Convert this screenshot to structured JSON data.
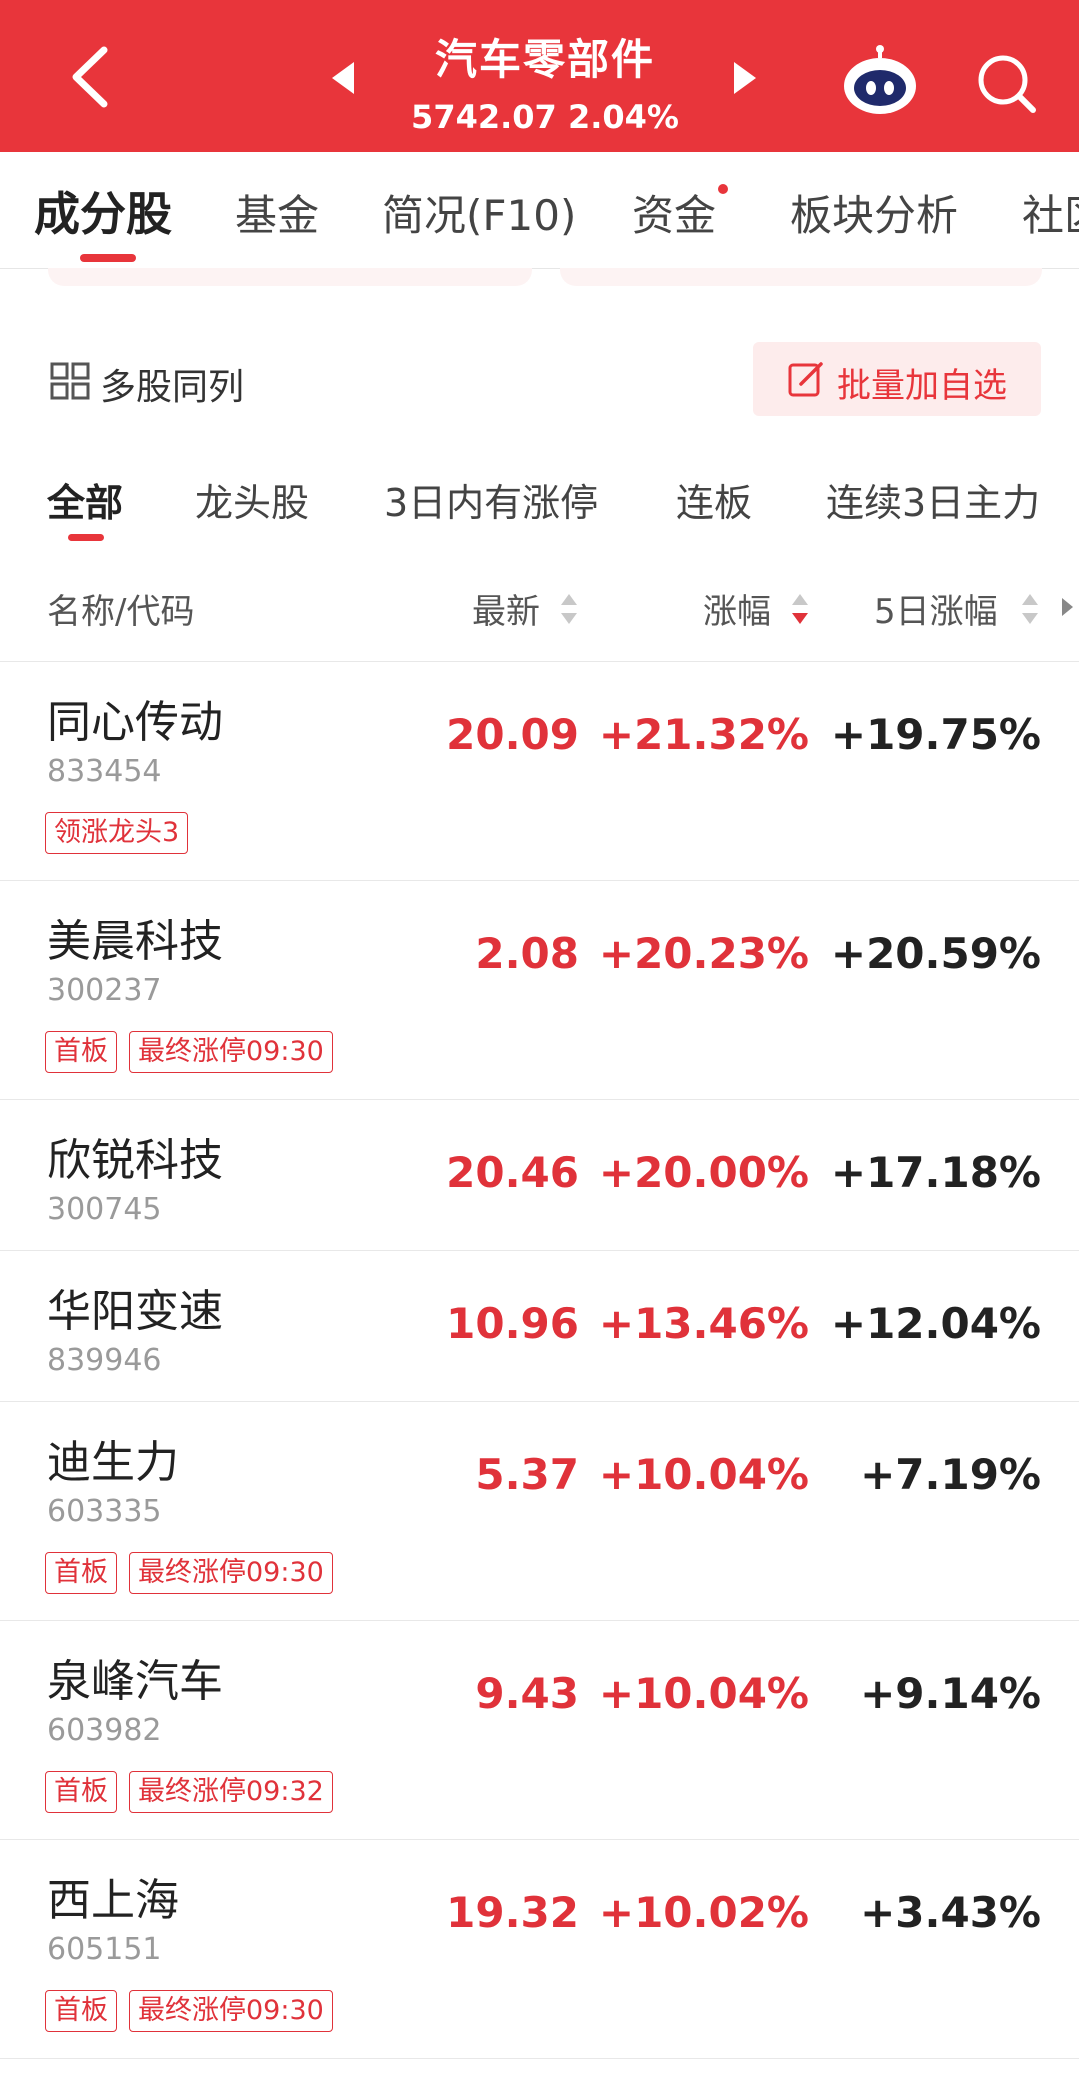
{
  "header": {
    "title": "汽车零部件",
    "index_value": "5742.07",
    "index_change": "2.04%",
    "accent": "#e8353b"
  },
  "tabs": [
    "成分股",
    "基金",
    "简况(F10)",
    "资金",
    "板块分析",
    "社区"
  ],
  "toolbar": {
    "multi_label": "多股同列",
    "batch_label": "批量加自选"
  },
  "filters": [
    "全部",
    "龙头股",
    "3日内有涨停",
    "连板",
    "连续3日主力"
  ],
  "table_header": {
    "name": "名称/代码",
    "latest": "最新",
    "change": "涨幅",
    "change5": "5日涨幅"
  },
  "rows": [
    {
      "name": "同心传动",
      "code": "833454",
      "price": "20.09",
      "change": "+21.32%",
      "change5": "+19.75%",
      "tags": [
        "领涨龙头3"
      ]
    },
    {
      "name": "美晨科技",
      "code": "300237",
      "price": "2.08",
      "change": "+20.23%",
      "change5": "+20.59%",
      "tags": [
        "首板",
        "最终涨停09:30"
      ]
    },
    {
      "name": "欣锐科技",
      "code": "300745",
      "price": "20.46",
      "change": "+20.00%",
      "change5": "+17.18%",
      "tags": []
    },
    {
      "name": "华阳变速",
      "code": "839946",
      "price": "10.96",
      "change": "+13.46%",
      "change5": "+12.04%",
      "tags": []
    },
    {
      "name": "迪生力",
      "code": "603335",
      "price": "5.37",
      "change": "+10.04%",
      "change5": "+7.19%",
      "tags": [
        "首板",
        "最终涨停09:30"
      ]
    },
    {
      "name": "泉峰汽车",
      "code": "603982",
      "price": "9.43",
      "change": "+10.04%",
      "change5": "+9.14%",
      "tags": [
        "首板",
        "最终涨停09:32"
      ]
    },
    {
      "name": "西上海",
      "code": "605151",
      "price": "19.32",
      "change": "+10.02%",
      "change5": "+3.43%",
      "tags": [
        "首板",
        "最终涨停09:30"
      ]
    }
  ]
}
